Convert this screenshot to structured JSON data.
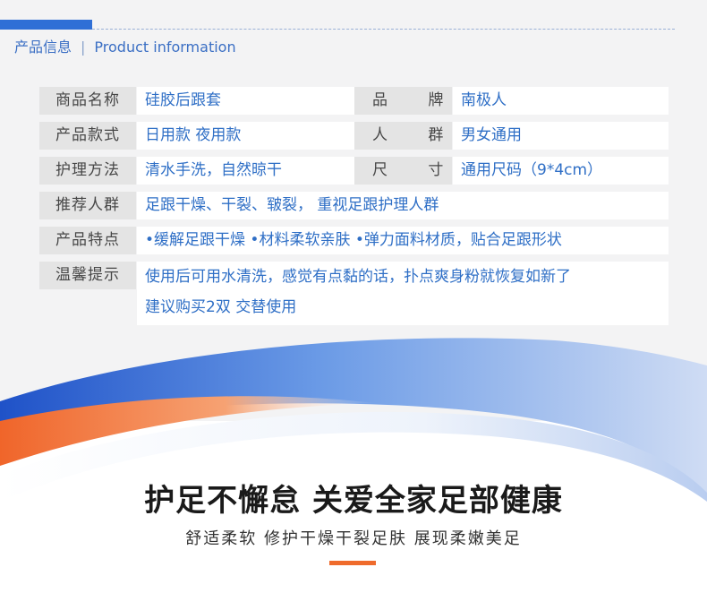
{
  "header": {
    "title_cn": "产品信息",
    "title_en": "Product information",
    "separator": "|"
  },
  "info": {
    "rows": [
      {
        "label1": "商品名称",
        "value1": "硅胶后跟套",
        "label2": "品 牌",
        "value2": "南极人"
      },
      {
        "label1": "产品款式",
        "value1": "日用款 夜用款",
        "label2": "人 群",
        "value2": "男女通用"
      },
      {
        "label1": "护理方法",
        "value1": "清水手洗，自然晾干",
        "label2": "尺 寸",
        "value2": "通用尺码（9*4cm）"
      }
    ],
    "recommend_label": "推荐人群",
    "recommend_value": "足跟干燥、干裂、皲裂， 重视足跟护理人群",
    "features_label": "产品特点",
    "features_value": "•缓解足跟干燥 •材料柔软亲肤 •弹力面料材质，贴合足跟形状",
    "tips_label": "温馨提示",
    "tips_line1": "使用后可用水清洗，感觉有点黏的话，扑点爽身粉就恢复如新了",
    "tips_line2": "建议购买2双 交替使用"
  },
  "banner": {
    "slogan": "护足不懈怠 关爱全家足部健康",
    "subslogan": "舒适柔软 修护干燥干裂足肤 展现柔嫩美足"
  },
  "colors": {
    "accent_blue": "#2f6fd6",
    "value_text": "#2f6fc6",
    "accent_orange": "#ef6b2c",
    "label_bg": "#e4e4e4",
    "page_bg": "#f3f3f4"
  }
}
